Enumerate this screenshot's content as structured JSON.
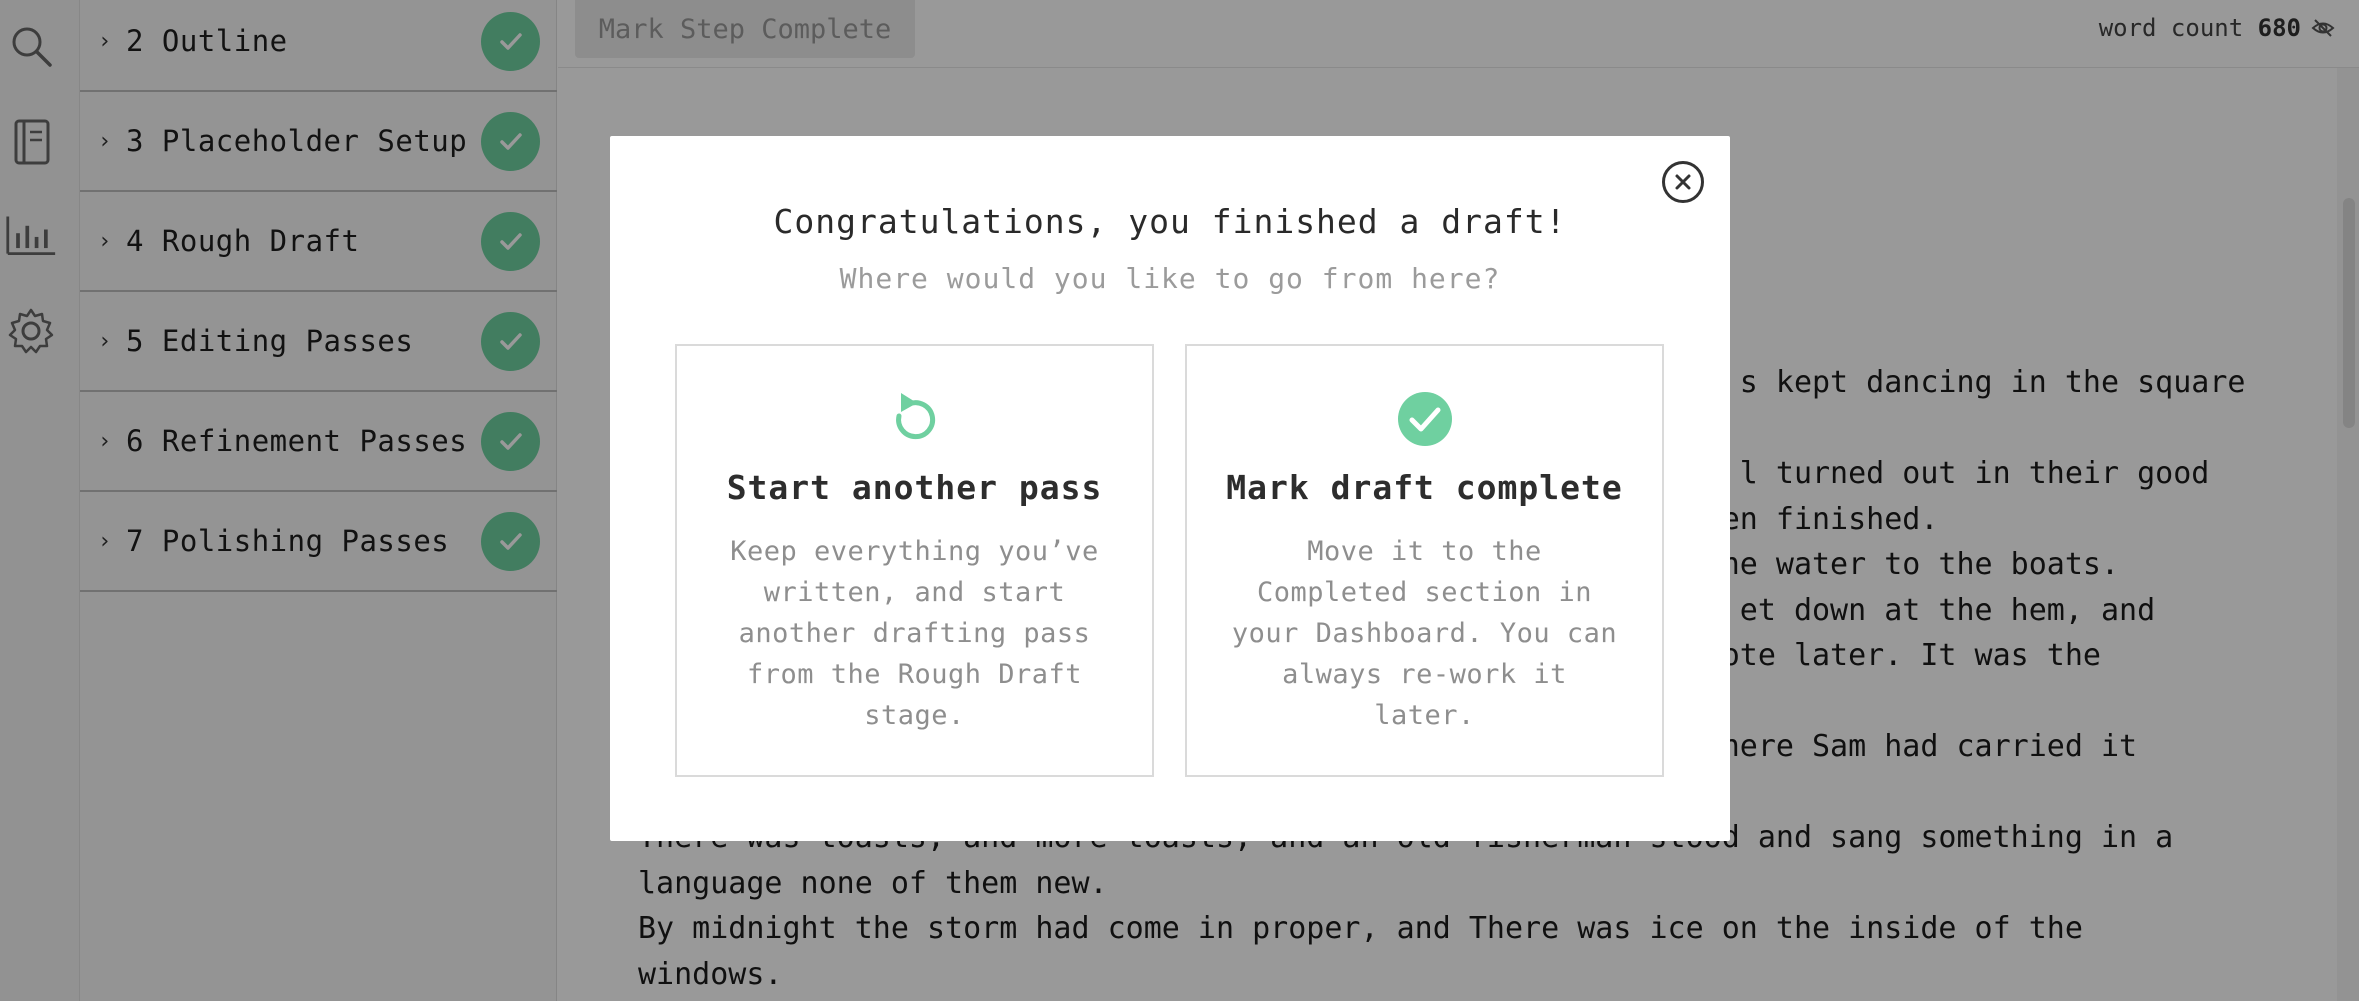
{
  "rail": {
    "icons": [
      "search-icon",
      "notebook-icon",
      "stats-icon",
      "gear-icon"
    ]
  },
  "steps": [
    {
      "label": "2 Outline",
      "complete": true
    },
    {
      "label": "3 Placeholder Setup",
      "complete": true
    },
    {
      "label": "4 Rough Draft",
      "complete": true
    },
    {
      "label": "5 Editing Passes",
      "complete": true
    },
    {
      "label": "6 Refinement Passes",
      "complete": true
    },
    {
      "label": "7 Polishing Passes",
      "complete": true
    }
  ],
  "topbar": {
    "mark_step_label": "Mark Step Complete",
    "word_count_label": "word count",
    "word_count_value": "680"
  },
  "document": {
    "lines": [
      "                                                             s kept dancing in the square",
      "",
      "                                                             l turned out in their good",
      "                                                            en finished.",
      "                                                            he water to the boats.",
      "                                                             et down at the hem, and",
      "                                                            ote later. It was the",
      "",
      "                                                           where Sam had carried it",
      "",
      "There was toasts, and more toasts, and an old fisherman stood and sang something in a",
      "language none of them new.",
      "By midnight the storm had come in proper, and There was ice on the inside of the",
      "windows."
    ]
  },
  "modal": {
    "title": "Congratulations, you finished a draft!",
    "subtitle": "Where would you like to go from here?",
    "options": [
      {
        "icon": "restart-icon",
        "title": "Start another pass",
        "description": "Keep everything you’ve written, and start another drafting pass from the Rough Draft stage."
      },
      {
        "icon": "check-circle-icon",
        "title": "Mark draft complete",
        "description": "Move it to the Completed section in your Dashboard. You can always re-work it later."
      }
    ]
  },
  "colors": {
    "accent_green": "#6fd0a0",
    "overlay": "rgba(0,0,0,0.40)"
  }
}
